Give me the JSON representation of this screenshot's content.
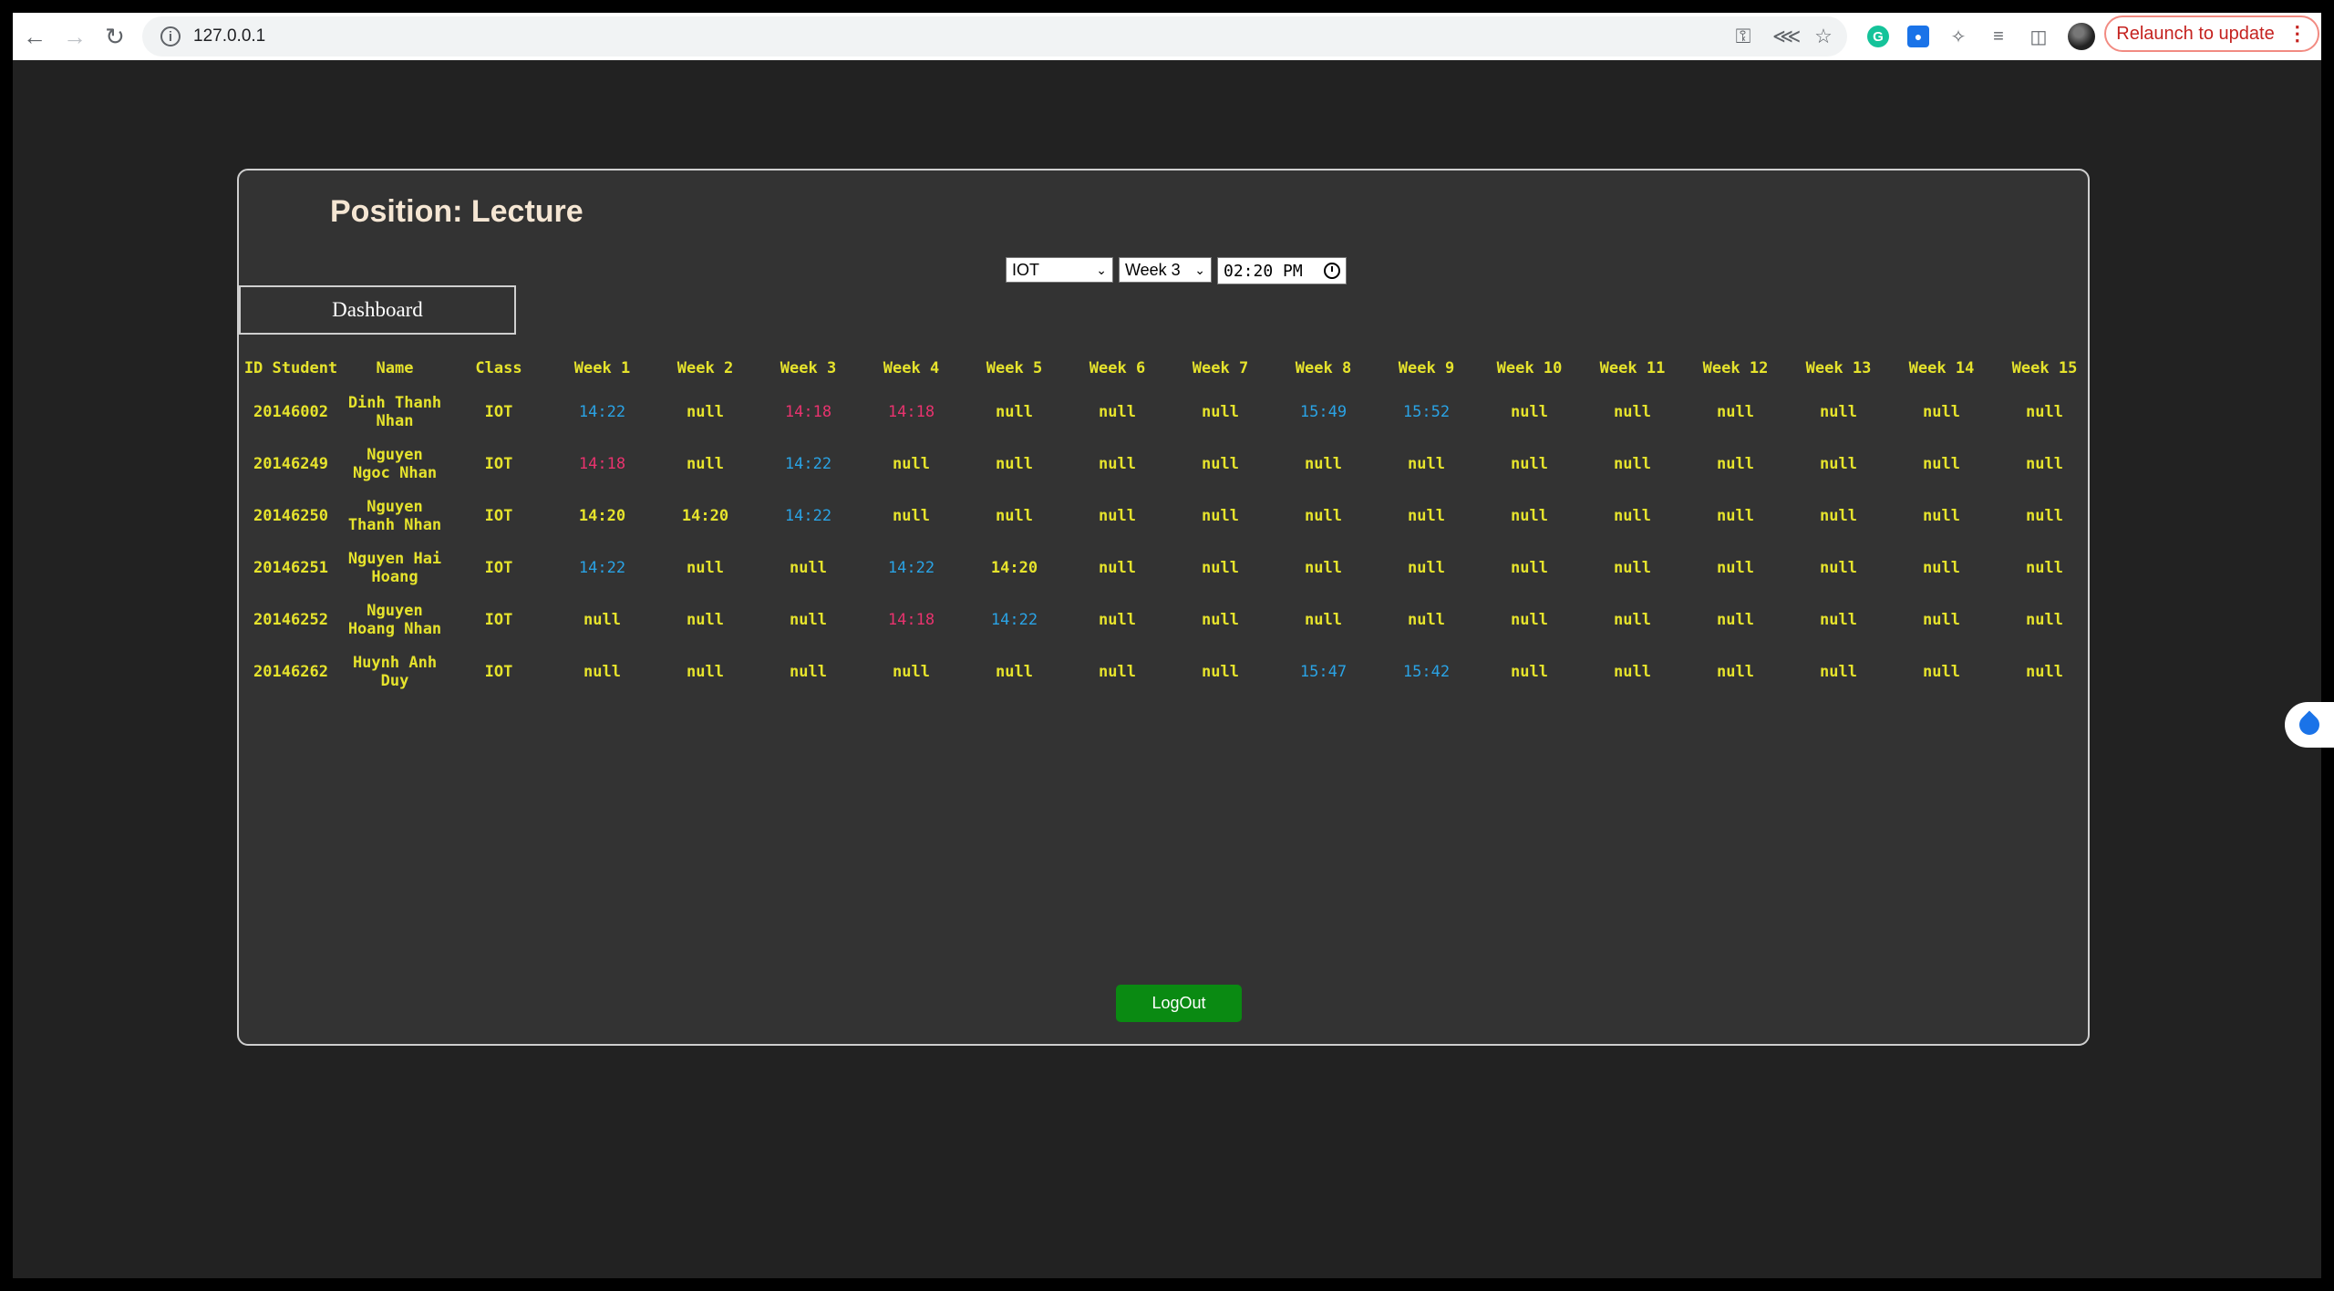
{
  "browser": {
    "url": "127.0.0.1",
    "relaunch_label": "Relaunch to update"
  },
  "page": {
    "position_title": "Position: Lecture",
    "class_select": "IOT",
    "week_select": "Week 3",
    "time_value": "02:20 PM",
    "dashboard_label": "Dashboard",
    "logout_label": "LogOut"
  },
  "table": {
    "headers": [
      "ID Student",
      "Name",
      "Class",
      "Week 1",
      "Week 2",
      "Week 3",
      "Week 4",
      "Week 5",
      "Week 6",
      "Week 7",
      "Week 8",
      "Week 9",
      "Week 10",
      "Week 11",
      "Week 12",
      "Week 13",
      "Week 14",
      "Week 15"
    ],
    "rows": [
      {
        "id": "20146002",
        "name": "Dinh Thanh Nhan",
        "class": "IOT",
        "weeks": [
          "14:22",
          "null",
          "14:18",
          "14:18",
          "null",
          "null",
          "null",
          "15:49",
          "15:52",
          "null",
          "null",
          "null",
          "null",
          "null",
          "null"
        ]
      },
      {
        "id": "20146249",
        "name": "Nguyen Ngoc Nhan",
        "class": "IOT",
        "weeks": [
          "14:18",
          "null",
          "14:22",
          "null",
          "null",
          "null",
          "null",
          "null",
          "null",
          "null",
          "null",
          "null",
          "null",
          "null",
          "null"
        ]
      },
      {
        "id": "20146250",
        "name": "Nguyen Thanh Nhan",
        "class": "IOT",
        "weeks": [
          "14:20",
          "14:20",
          "14:22",
          "null",
          "null",
          "null",
          "null",
          "null",
          "null",
          "null",
          "null",
          "null",
          "null",
          "null",
          "null"
        ]
      },
      {
        "id": "20146251",
        "name": "Nguyen Hai Hoang",
        "class": "IOT",
        "weeks": [
          "14:22",
          "null",
          "null",
          "14:22",
          "14:20",
          "null",
          "null",
          "null",
          "null",
          "null",
          "null",
          "null",
          "null",
          "null",
          "null"
        ]
      },
      {
        "id": "20146252",
        "name": "Nguyen Hoang Nhan",
        "class": "IOT",
        "weeks": [
          "null",
          "null",
          "null",
          "14:18",
          "14:22",
          "null",
          "null",
          "null",
          "null",
          "null",
          "null",
          "null",
          "null",
          "null",
          "null"
        ]
      },
      {
        "id": "20146262",
        "name": "Huynh Anh Duy",
        "class": "IOT",
        "weeks": [
          "null",
          "null",
          "null",
          "null",
          "null",
          "null",
          "null",
          "15:47",
          "15:42",
          "null",
          "null",
          "null",
          "null",
          "null",
          "null"
        ]
      }
    ],
    "cell_colors": [
      [
        "blue",
        "yellow",
        "pink",
        "pink",
        "yellow",
        "yellow",
        "yellow",
        "blue",
        "blue",
        "yellow",
        "yellow",
        "yellow",
        "yellow",
        "yellow",
        "yellow"
      ],
      [
        "pink",
        "yellow",
        "blue",
        "yellow",
        "yellow",
        "yellow",
        "yellow",
        "yellow",
        "yellow",
        "yellow",
        "yellow",
        "yellow",
        "yellow",
        "yellow",
        "yellow"
      ],
      [
        "yellow",
        "yellow",
        "blue",
        "yellow",
        "yellow",
        "yellow",
        "yellow",
        "yellow",
        "yellow",
        "yellow",
        "yellow",
        "yellow",
        "yellow",
        "yellow",
        "yellow"
      ],
      [
        "blue",
        "yellow",
        "yellow",
        "blue",
        "yellow",
        "yellow",
        "yellow",
        "yellow",
        "yellow",
        "yellow",
        "yellow",
        "yellow",
        "yellow",
        "yellow",
        "yellow"
      ],
      [
        "yellow",
        "yellow",
        "yellow",
        "pink",
        "blue",
        "yellow",
        "yellow",
        "yellow",
        "yellow",
        "yellow",
        "yellow",
        "yellow",
        "yellow",
        "yellow",
        "yellow"
      ],
      [
        "yellow",
        "yellow",
        "yellow",
        "yellow",
        "yellow",
        "yellow",
        "yellow",
        "blue",
        "blue",
        "yellow",
        "yellow",
        "yellow",
        "yellow",
        "yellow",
        "yellow"
      ]
    ]
  },
  "colors": {
    "text_yellow": "#e6e32c",
    "on_time_blue": "#2aa3e5",
    "late_pink": "#e8336e",
    "logout_green": "#0a8a12",
    "panel_bg": "#333333",
    "page_bg": "#222222"
  }
}
